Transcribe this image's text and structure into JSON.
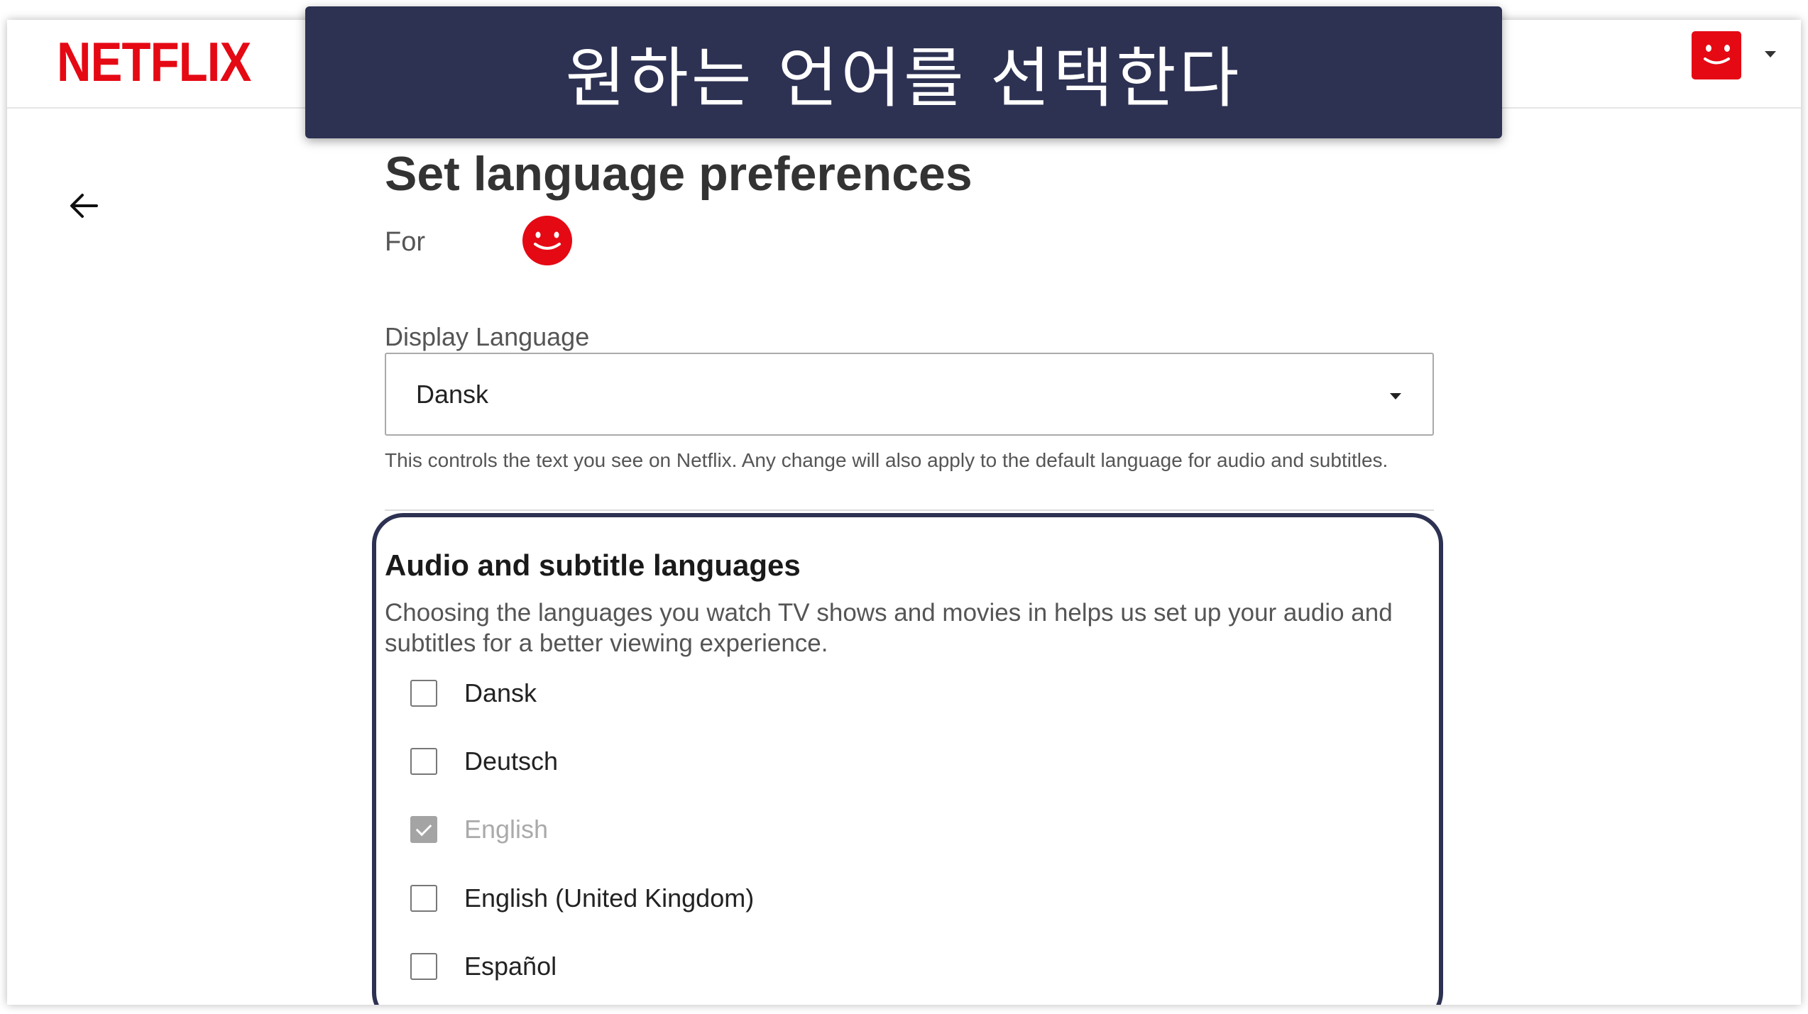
{
  "header": {
    "logo_text": "NETFLIX",
    "brand_color": "#e50914",
    "profile_menu_icon": "smiley-avatar-icon"
  },
  "banner": {
    "text": "원하는 언어를 선택한다",
    "background_color": "#2d3152"
  },
  "page": {
    "back_icon": "arrow-left-icon",
    "title": "Set language preferences",
    "for_label": "For"
  },
  "display_language": {
    "label": "Display Language",
    "selected": "Dansk",
    "helper_text": "This controls the text you see on Netflix. Any change will also apply to the default language for audio and subtitles."
  },
  "audio_subtitle": {
    "title": "Audio and subtitle languages",
    "description": "Choosing the languages you watch TV shows and movies in helps us set up your audio and subtitles for a better viewing experience.",
    "languages": [
      {
        "label": "Dansk",
        "checked": false,
        "disabled": false
      },
      {
        "label": "Deutsch",
        "checked": false,
        "disabled": false
      },
      {
        "label": "English",
        "checked": true,
        "disabled": true
      },
      {
        "label": "English (United Kingdom)",
        "checked": false,
        "disabled": false
      },
      {
        "label": "Español",
        "checked": false,
        "disabled": false
      }
    ]
  }
}
